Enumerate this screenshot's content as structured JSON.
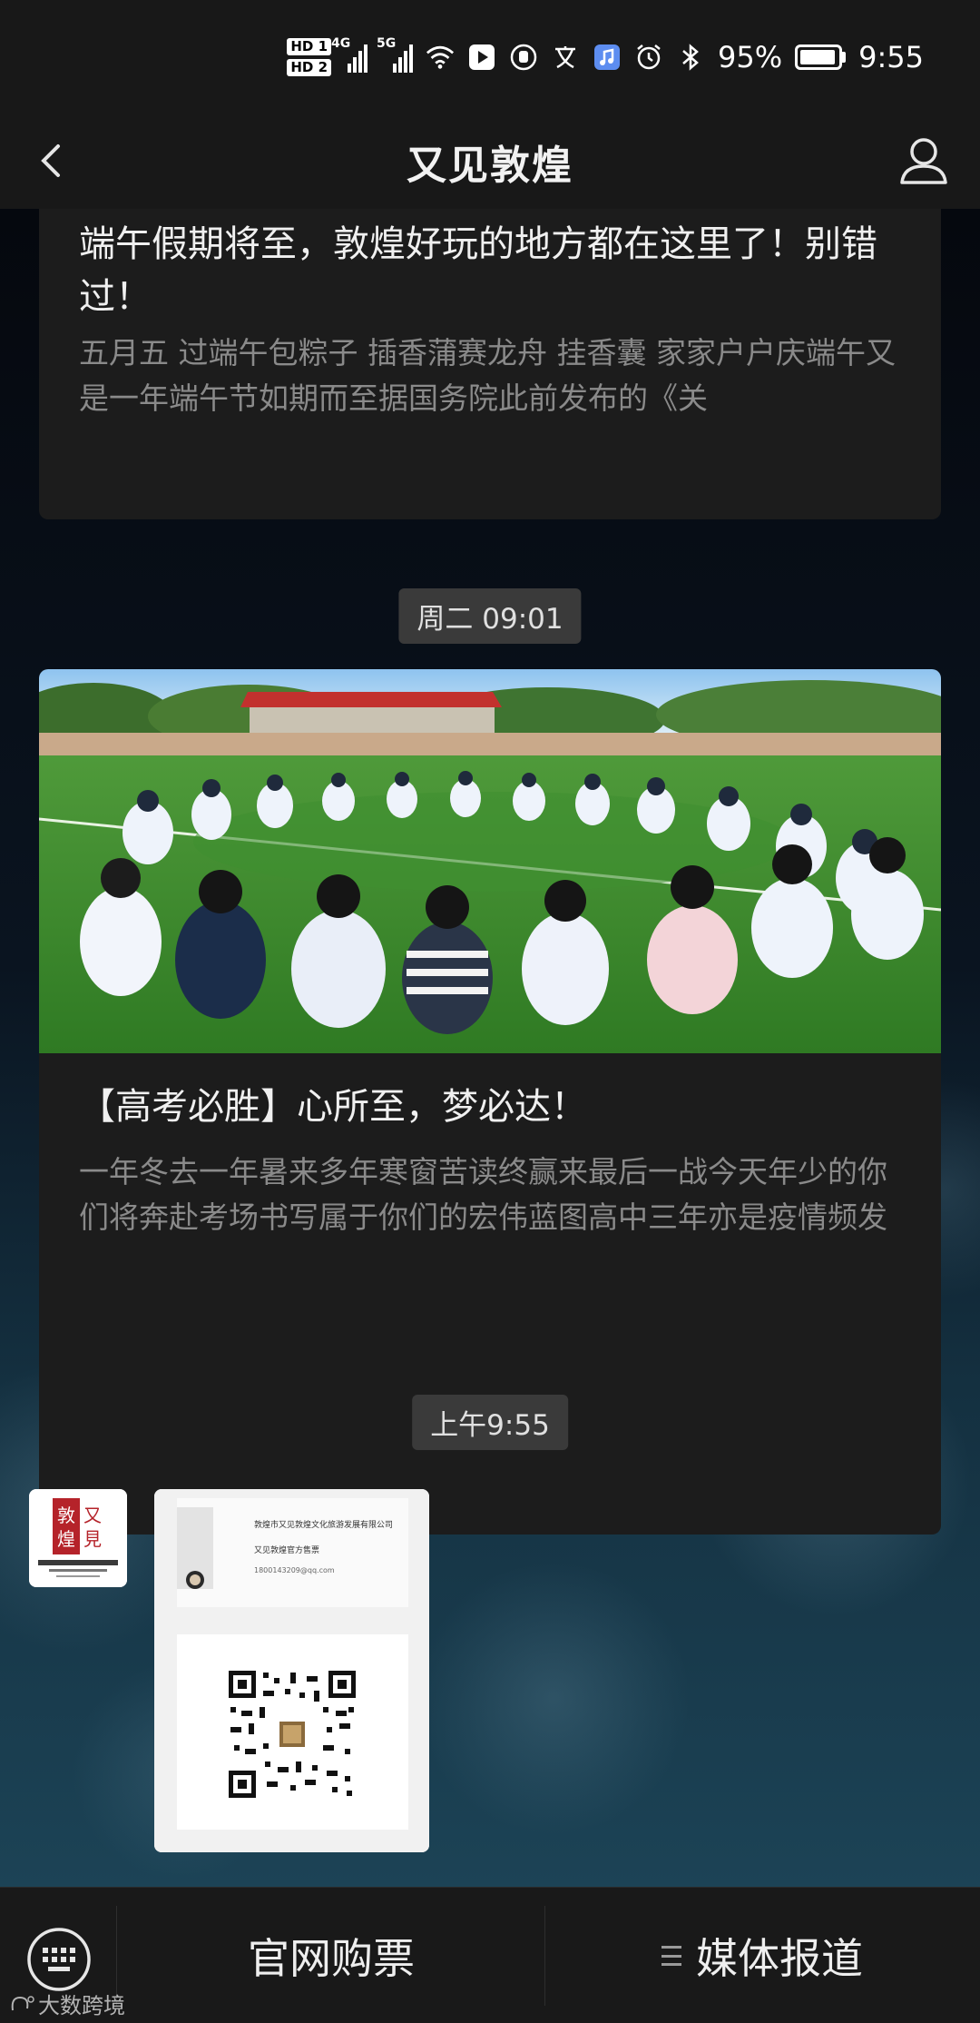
{
  "status_bar": {
    "hd1": "HD 1",
    "hd2": "HD 2",
    "sim1": "4G",
    "sim2": "5G",
    "battery_percent": "95%",
    "battery_level": 0.95,
    "time": "9:55"
  },
  "header": {
    "title": "又见敦煌"
  },
  "messages": [
    {
      "type": "article",
      "title": "端午假期将至，敦煌好玩的地方都在这里了！别错过！",
      "summary": "五月五  过端午包粽子  插香蒲赛龙舟  挂香囊 家家户户庆端午又是一年端午节如期而至据国务院此前发布的《关"
    },
    {
      "type": "timestamp",
      "text": "周二 09:01"
    },
    {
      "type": "article",
      "title": "【高考必胜】心所至，梦必达！",
      "summary": "一年冬去一年暑来多年寒窗苦读终赢来最后一战今天年少的你们将奔赴考场书写属于你们的宏伟蓝图高中三年亦是疫情频发"
    },
    {
      "type": "timestamp",
      "text": "上午9:55"
    },
    {
      "type": "image",
      "company": "敦煌市又见敦煌文化旅游发展有限公司",
      "subtitle": "又见敦煌官方售票",
      "email": "1800143209@qq.com"
    }
  ],
  "avatar": {
    "line": "又見敦煌",
    "en": "ENCORE DUNHUANG"
  },
  "bottom_menu": {
    "item1": "官网购票",
    "item2": "媒体报道"
  },
  "watermark": "大数跨境",
  "icons": {
    "back": "chevron-left-icon",
    "profile": "person-icon",
    "keyboard": "keyboard-icon",
    "menu": "hamburger-icon"
  },
  "colors": {
    "bar_bg": "#181818",
    "card_bg": "#1c1c1c",
    "chip_bg": "#3a3a3a",
    "text_gray": "#8a8a8a"
  }
}
